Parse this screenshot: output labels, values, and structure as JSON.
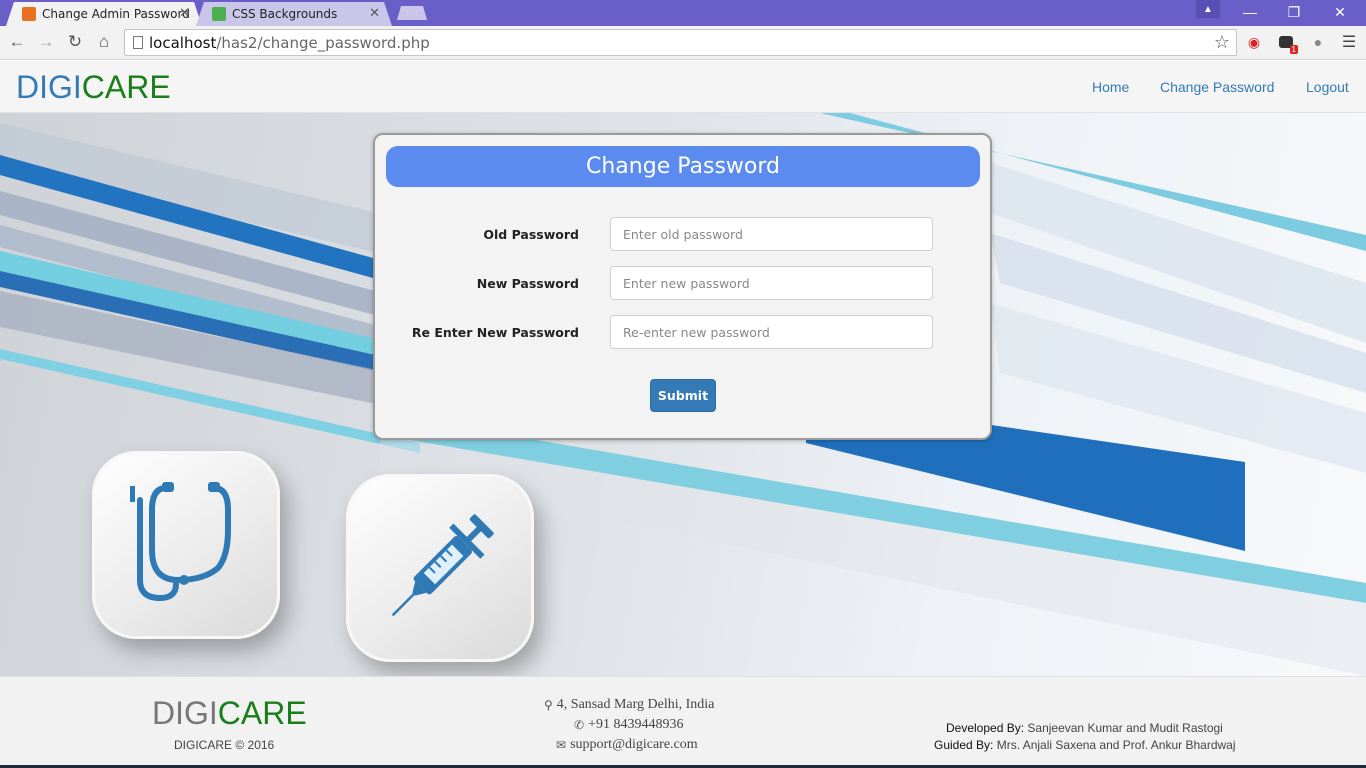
{
  "browser": {
    "tabs": [
      {
        "title": "Change Admin Password",
        "active": true,
        "favicon_color": "#e8701e"
      },
      {
        "title": "CSS Backgrounds",
        "active": false,
        "favicon_color": "#4caf50"
      }
    ],
    "url_host": "localhost",
    "url_path": "/has2/change_password.php",
    "extension_badge": "1"
  },
  "site": {
    "logo_part1": "DIGI",
    "logo_part2": "CARE",
    "nav": {
      "home": "Home",
      "change_password": "Change Password",
      "logout": "Logout"
    }
  },
  "form": {
    "title": "Change Password",
    "fields": [
      {
        "label": "Old Password",
        "placeholder": "Enter old password",
        "value": ""
      },
      {
        "label": "New Password",
        "placeholder": "Enter new password",
        "value": ""
      },
      {
        "label": "Re Enter New Password",
        "placeholder": "Re-enter new password",
        "value": ""
      }
    ],
    "submit_label": "Submit"
  },
  "footer": {
    "logo_part1": "DIGI",
    "logo_part2": "CARE",
    "copyright": "DIGICARE © 2016",
    "address": "4, Sansad Marg Delhi, India",
    "phone": "+91 8439448936",
    "email": "support@digicare.com",
    "developed_by_label": "Developed By:",
    "developed_by": "Sanjeevan Kumar and Mudit Rastogi",
    "guided_by_label": "Guided By:",
    "guided_by": "Mrs. Anjali Saxena and Prof. Ankur Bhardwaj"
  },
  "colors": {
    "primary_blue": "#337ab7",
    "logo_green": "#1a7f1a",
    "panel_header": "#5b8bef",
    "titlebar": "#6a5fc9"
  }
}
